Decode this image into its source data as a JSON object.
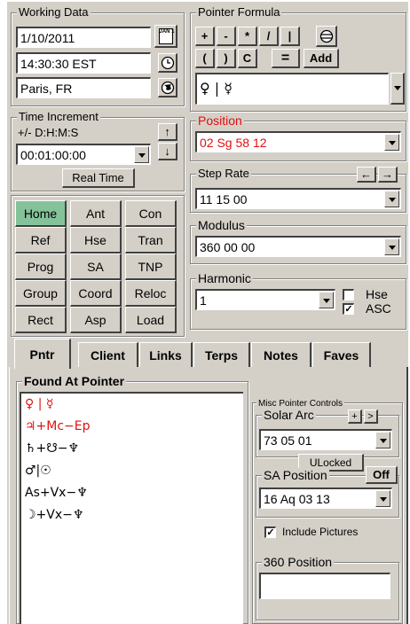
{
  "working_data": {
    "legend": "Working Data",
    "date": "1/10/2011",
    "time": "14:30:30  EST",
    "place": "Paris, FR",
    "date_icon": "calendar-icon",
    "time_icon": "clock-icon",
    "place_icon": "globe-icon",
    "calendar_label": "JAN 1"
  },
  "time_increment": {
    "legend": "Time Increment",
    "format": "+/- D:H:M:S",
    "value": "00:01:00:00",
    "up_icon": "↑",
    "down_icon": "↓",
    "real_time_label": "Real Time"
  },
  "nav_buttons": [
    [
      "Home",
      "Ant",
      "Con"
    ],
    [
      "Ref",
      "Hse",
      "Tran"
    ],
    [
      "Prog",
      "SA",
      "TNP"
    ],
    [
      "Group",
      "Coord",
      "Reloc"
    ],
    [
      "Rect",
      "Asp",
      "Load"
    ]
  ],
  "active_nav": "Home",
  "active_color": "#84c39a",
  "pointer_formula": {
    "legend": "Pointer Formula",
    "ops_row1": [
      "+",
      "-",
      "*",
      "/",
      "|"
    ],
    "ops_row2": [
      "(",
      ")",
      "C"
    ],
    "equals_label": "=",
    "add_label": "Add",
    "formula": "♀ | ☿"
  },
  "position": {
    "legend": "Position",
    "value": "02 Sg 58 12",
    "color": "#e01010"
  },
  "step_rate": {
    "legend": "Step Rate",
    "value": "11 15 00",
    "left_label": "←",
    "right_label": "→"
  },
  "modulus": {
    "legend": "Modulus",
    "value": "360 00 00"
  },
  "harmonic": {
    "legend": "Harmonic",
    "value": "1",
    "hse_label": "Hse",
    "asc_label": "ASC",
    "hse_checked": false,
    "asc_checked": true
  },
  "tabs": [
    "Pntr",
    "Client",
    "Links",
    "Terps",
    "Notes",
    "Faves"
  ],
  "active_tab": "Pntr",
  "found_at_pointer": {
    "legend": "Found At Pointer",
    "items": [
      {
        "text": "♀ | ☿",
        "color": "#e01010"
      },
      {
        "text": "♃+Mc−Ep",
        "color": "#e01010"
      },
      {
        "text": "♄+☋−♆",
        "color": "#000000"
      },
      {
        "text": "♂|☉",
        "color": "#000000"
      },
      {
        "text": "As+Vx−♆",
        "color": "#000000"
      },
      {
        "text": "☽+Vx−♆",
        "color": "#000000"
      }
    ]
  },
  "misc": {
    "legend": "Misc Pointer Controls",
    "solar_arc_label": "Solar Arc",
    "solar_arc_plus": "+",
    "solar_arc_next": ">",
    "solar_arc_value": "73 05 01",
    "ulocked_label": "ULocked",
    "sa_position_label": "SA Position",
    "sa_off_label": "Off",
    "sa_position_value": "16 Aq 03 13",
    "include_pictures_label": "Include Pictures",
    "include_pictures_checked": true,
    "pos360_label": "360 Position",
    "pos360_value": ""
  }
}
